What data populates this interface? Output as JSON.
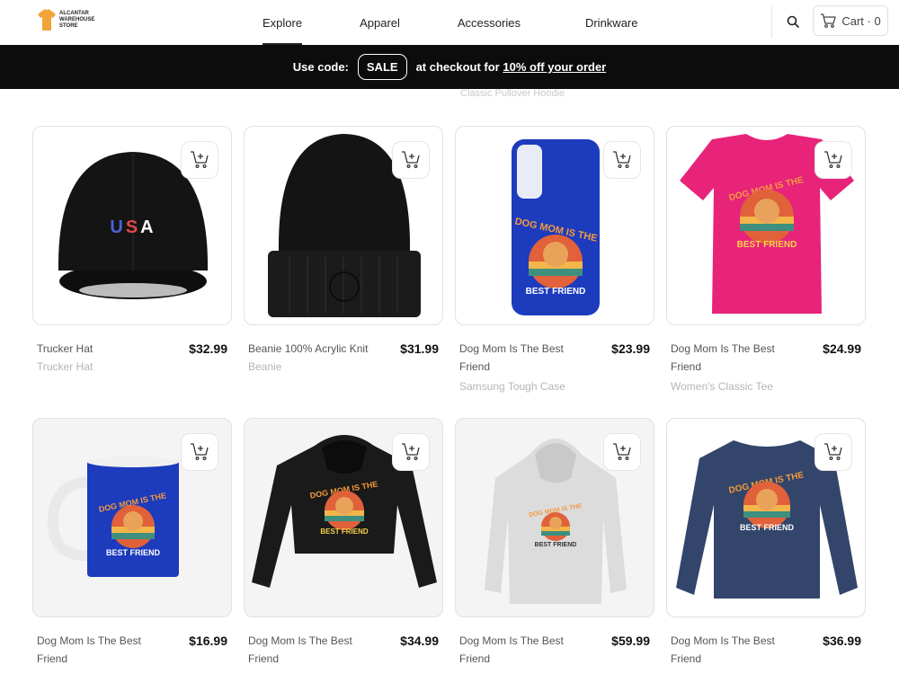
{
  "header": {
    "logo_lines": [
      "ALCANTAR",
      "WAREHOUSE",
      "STORE"
    ],
    "nav": [
      {
        "label": "Explore",
        "active": true
      },
      {
        "label": "Apparel",
        "active": false
      },
      {
        "label": "Accessories",
        "active": false
      },
      {
        "label": "Drinkware",
        "active": false
      }
    ],
    "search_icon": "search-icon",
    "cart_label": "Cart · 0"
  },
  "promo": {
    "prefix": "Use code:",
    "code": "SALE",
    "middle": "at checkout for",
    "link": "10% off your order"
  },
  "ghost_text": "Classic Pullover Hoodie",
  "products": [
    {
      "title": "Trucker Hat",
      "price": "$32.99",
      "subtitle": "Trucker Hat",
      "image": "black trucker hat USA"
    },
    {
      "title": "Beanie 100% Acrylic Knit",
      "price": "$31.99",
      "subtitle": "Beanie",
      "image": "black beanie"
    },
    {
      "title": "Dog Mom Is The Best Friend",
      "price": "$23.99",
      "subtitle": "Samsung Tough Case",
      "image": "blue phone case"
    },
    {
      "title": "Dog Mom Is The Best Friend",
      "price": "$24.99",
      "subtitle": "Women's Classic Tee",
      "image": "pink t-shirt"
    },
    {
      "title": "Dog Mom Is The Best Friend",
      "price": "$16.99",
      "subtitle": "",
      "image": "blue mug"
    },
    {
      "title": "Dog Mom Is The Best Friend",
      "price": "$34.99",
      "subtitle": "",
      "image": "black cropped hoodie"
    },
    {
      "title": "Dog Mom Is The Best Friend",
      "price": "$59.99",
      "subtitle": "",
      "image": "white hoodie"
    },
    {
      "title": "Dog Mom Is The Best Friend",
      "price": "$36.99",
      "subtitle": "",
      "image": "navy sweatshirt"
    }
  ],
  "design_text": {
    "line1": "DOG MOM IS THE",
    "line2": "BEST FRIEND",
    "usa": "USA"
  },
  "colors": {
    "accent": "#0c0c0c",
    "pink": "#e8237a",
    "blue": "#1d3bbd",
    "navy": "#33456a"
  }
}
